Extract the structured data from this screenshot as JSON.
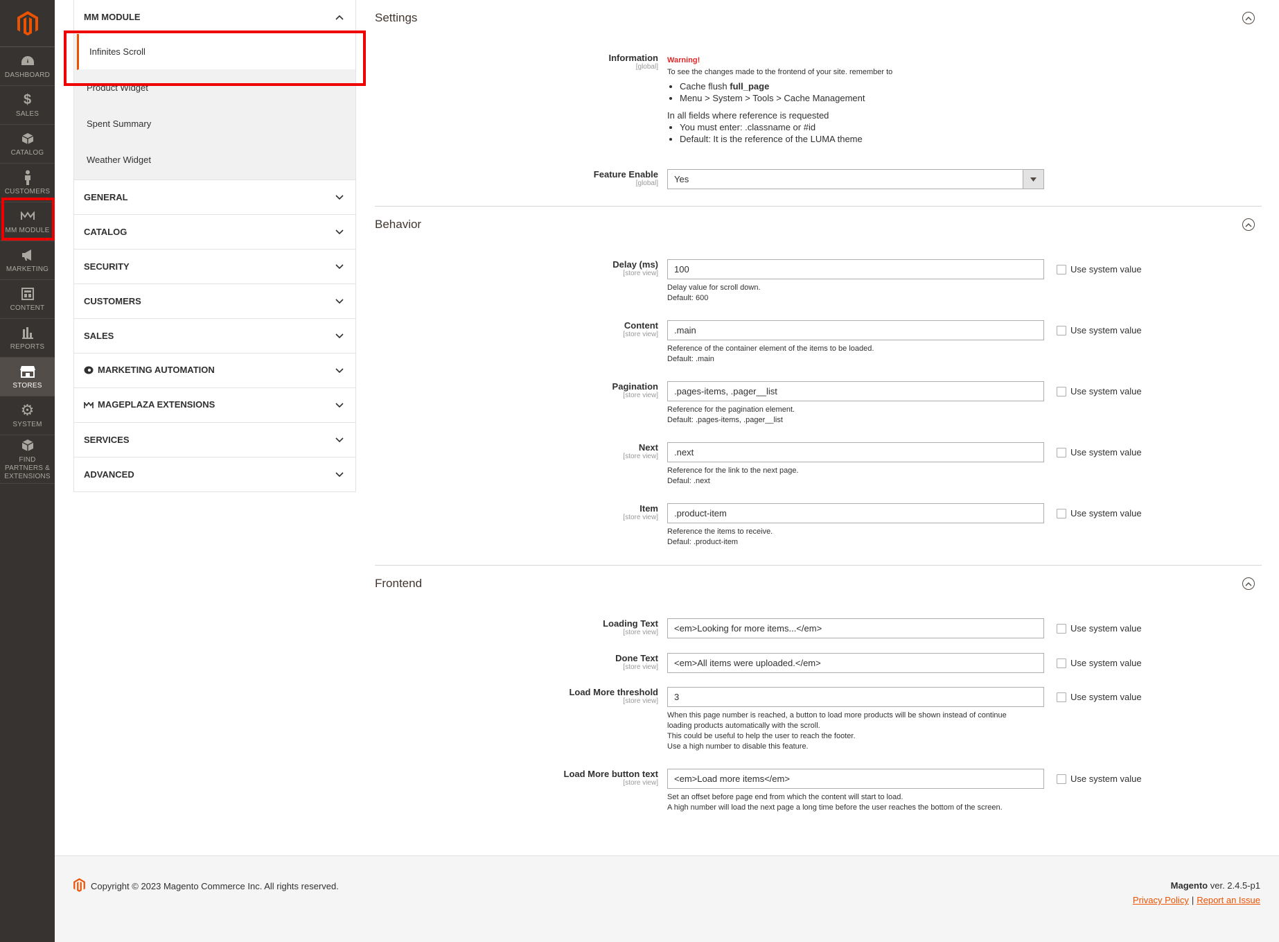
{
  "nav": {
    "items": [
      {
        "label": "DASHBOARD",
        "icon": "dashboard-icon"
      },
      {
        "label": "SALES",
        "icon": "dollar-icon"
      },
      {
        "label": "CATALOG",
        "icon": "box-icon"
      },
      {
        "label": "CUSTOMERS",
        "icon": "person-icon"
      },
      {
        "label": "MM MODULE",
        "icon": "mm-logo-icon"
      },
      {
        "label": "MARKETING",
        "icon": "megaphone-icon"
      },
      {
        "label": "CONTENT",
        "icon": "layout-icon"
      },
      {
        "label": "REPORTS",
        "icon": "bar-chart-icon"
      },
      {
        "label": "STORES",
        "icon": "store-icon"
      },
      {
        "label": "SYSTEM",
        "icon": "gear-icon"
      },
      {
        "label": "FIND PARTNERS & EXTENSIONS",
        "icon": "cubes-icon"
      }
    ],
    "active": "STORES",
    "accent": "#eb5202"
  },
  "tabs": {
    "mm_module": {
      "title": "MM MODULE",
      "items": [
        "Infinites Scroll",
        "Product Widget",
        "Spent Summary",
        "Weather Widget"
      ],
      "active": "Infinites Scroll"
    },
    "groups": [
      "GENERAL",
      "CATALOG",
      "SECURITY",
      "CUSTOMERS",
      "SALES",
      "MARKETING AUTOMATION",
      "MAGEPLAZA EXTENSIONS",
      "SERVICES",
      "ADVANCED"
    ]
  },
  "settings": {
    "title": "Settings",
    "information": {
      "label": "Information",
      "scope": "[global]",
      "warning": "Warning!",
      "intro": "To see the changes made to the frontend of your site. remember to",
      "list1": [
        "Cache flush ",
        "Menu > System > Tools > Cache Management"
      ],
      "list1_bold": "full_page",
      "para": "In all fields where reference is requested",
      "list2": [
        "You must enter: .classname or #id",
        "Default: It is the reference of the LUMA theme"
      ]
    },
    "feature_enable": {
      "label": "Feature Enable",
      "scope": "[global]",
      "value": "Yes"
    }
  },
  "behavior": {
    "title": "Behavior",
    "fields": [
      {
        "label": "Delay (ms)",
        "scope": "[store view]",
        "value": "100",
        "note1": "Delay value for scroll down.",
        "note2": "Default: 600"
      },
      {
        "label": "Content",
        "scope": "[store view]",
        "value": ".main",
        "note1": "Reference of the container element of the items to be loaded.",
        "note2": "Default: .main"
      },
      {
        "label": "Pagination",
        "scope": "[store view]",
        "value": ".pages-items, .pager__list",
        "note1": "Reference for the pagination element.",
        "note2": "Default: .pages-items, .pager__list"
      },
      {
        "label": "Next",
        "scope": "[store view]",
        "value": ".next",
        "note1": "Reference for the link to the next page.",
        "note2": "Defaul: .next"
      },
      {
        "label": "Item",
        "scope": "[store view]",
        "value": ".product-item",
        "note1": "Reference the items to receive.",
        "note2": "Defaul: .product-item"
      }
    ]
  },
  "frontend": {
    "title": "Frontend",
    "fields": [
      {
        "label": "Loading Text",
        "scope": "[store view]",
        "value": "<em>Looking for more items...</em>"
      },
      {
        "label": "Done Text",
        "scope": "[store view]",
        "value": "<em>All items were uploaded.</em>"
      },
      {
        "label": "Load More threshold",
        "scope": "[store view]",
        "value": "3",
        "notes": [
          "When this page number is reached, a button to load more products will be shown instead of continue",
          "loading products automatically with the scroll.",
          "This could be useful to help the user to reach the footer.",
          "Use a high number to disable this feature."
        ]
      },
      {
        "label": "Load More button text",
        "scope": "[store view]",
        "value": "<em>Load more items</em>",
        "notes": [
          "Set an offset before page end from which the content will start to load.",
          "A high number will load the next page a long time before the user reaches the bottom of the screen."
        ]
      }
    ]
  },
  "use_system_value": "Use system value",
  "footer": {
    "copyright": "Copyright © 2023 Magento Commerce Inc. All rights reserved.",
    "brand": "Magento",
    "version": " ver. 2.4.5-p1",
    "privacy": "Privacy Policy",
    "separator": "|",
    "report": "Report an Issue"
  }
}
